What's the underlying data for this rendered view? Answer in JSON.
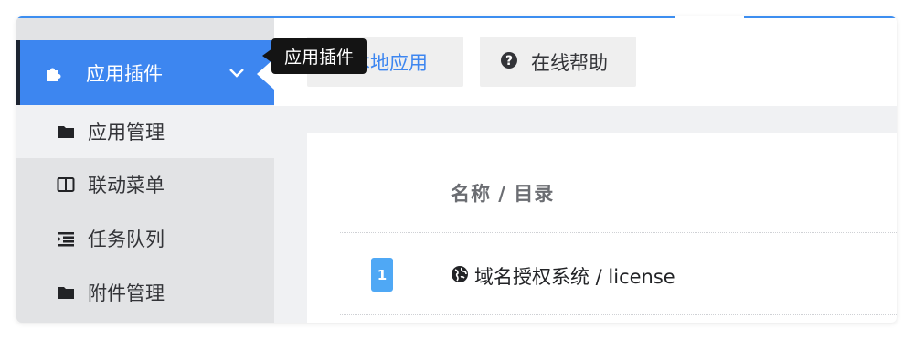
{
  "sidebar": {
    "active_item": {
      "label": "应用插件",
      "icon": "puzzle-piece-icon",
      "chevron": "chevron-down-icon"
    },
    "items": [
      {
        "label": "应用管理",
        "icon": "folder-icon"
      },
      {
        "label": "联动菜单",
        "icon": "columns-icon"
      },
      {
        "label": "任务队列",
        "icon": "indent-list-icon"
      },
      {
        "label": "附件管理",
        "icon": "folder-icon"
      }
    ]
  },
  "tooltip": {
    "text": "应用插件"
  },
  "toolbar": {
    "local_apps_label": "本地应用",
    "local_apps_icon": "user-icon",
    "help_label": "在线帮助",
    "help_icon": "question-circle-icon"
  },
  "table": {
    "header": "名称 / 目录",
    "rows": [
      {
        "index": "1",
        "icon": "globe-icon",
        "name": "域名授权系统 / license"
      }
    ]
  },
  "colors": {
    "accent": "#3d86f0",
    "sidebar_bg": "#e2e3e5",
    "badge": "#4fa8f5",
    "tooltip_bg": "#141414"
  }
}
